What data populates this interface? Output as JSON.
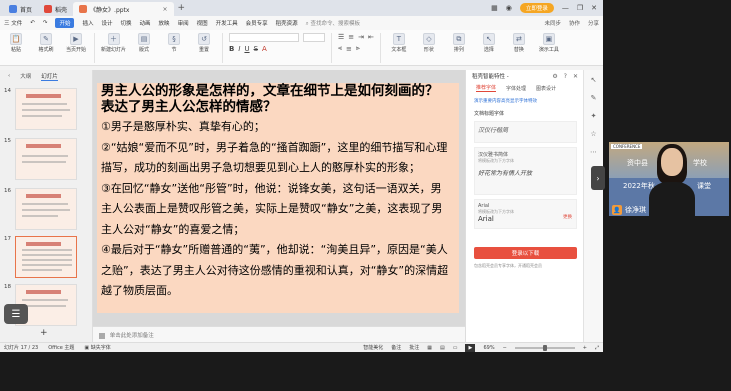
{
  "tabs": [
    {
      "label": "首页",
      "color": "#4a7fe0"
    },
    {
      "label": "稻壳",
      "color": "#e0483a"
    },
    {
      "label": "《静女》.pptx",
      "color": "#e8744a"
    }
  ],
  "window_right": {
    "login_label": "立即登录"
  },
  "menu": {
    "file": "三 文件",
    "start": "开始",
    "items": [
      "插入",
      "设计",
      "切换",
      "动画",
      "放映",
      "审阅",
      "视图",
      "开发工具",
      "会员专享",
      "稻壳资源"
    ],
    "search_placeholder": "查找命令、搜索模板",
    "right": [
      "未同步",
      "协作",
      "分享"
    ]
  },
  "ribbon": {
    "paste": "粘贴",
    "format_painter": "格式刷",
    "current_page_start": "当页开始",
    "new_slide": "新建幻灯片",
    "layout": "版式",
    "section": "节",
    "reset": "重置",
    "textbox": "文本框",
    "shape": "形状",
    "arrange": "排列",
    "select": "选择",
    "replace": "替换",
    "animation": "演示工具"
  },
  "left_pane": {
    "tab_outline": "大纲",
    "tab_slides": "幻灯片",
    "slides": [
      {
        "num": "14"
      },
      {
        "num": "15"
      },
      {
        "num": "16"
      },
      {
        "num": "17"
      },
      {
        "num": "18"
      }
    ]
  },
  "slide": {
    "title": "男主人公的形象是怎样的，文章在细节上是如何刻画的？表达了男主人公怎样的情感？",
    "lines": [
      "①男子是憨厚朴实、真挚有心的；",
      "②“姑娘“爱而不见”时，男子着急的“搔首踟蹰”，这里的细节描写和心理描写，成功的刻画出男子急切想要见到心上人的憨厚朴实的形象；",
      "③在回忆“静女”送他“彤管”时，他说：说锋女美，这句话一语双关，男主人公表面上是赞叹彤管之美，实际上是赞叹“静女”之美，这表现了男主人公对“静女”的喜爱之情；",
      "④最后对于“静女”所赠普通的“荑”，他却说：“洵美且异”，原因是“美人之贻”，表达了男主人公对待这份感情的重视和认真，对“静女”的深情超越了物质层面。"
    ]
  },
  "notes": "单击此处添加备注",
  "right_pane": {
    "title": "稻壳智能特性 -",
    "tabs": [
      "推荐字体",
      "字体处理",
      "图表设计"
    ],
    "link": "演示重要内容高亮显示字体特效",
    "head": "文档标题字体",
    "font1_sample": "汉仪行楷简",
    "font2_name": "汉仪雅书简体",
    "font2_sub": "将模板改为下方字体",
    "font2_sample": "好花常为有情人开放",
    "font3_name": "Arial",
    "font3_sub": "将模板改为下方字体",
    "font3_sample": "Arial",
    "font3_tag": "更换",
    "download": "登录以下载",
    "note": "包含稻壳会员专享字体，开通稻壳会员"
  },
  "statusbar": {
    "page": "幻灯片 17 / 23",
    "theme": "Office 主题",
    "missing_font": "缺失字体",
    "smart_beautify": "智能美化",
    "notes": "备注",
    "comment": "批注",
    "zoom": "69%"
  },
  "cam": {
    "tag": "CONFERENCE",
    "line1": "资中县",
    "line1b": "学校",
    "line2": "2022年秋",
    "line2b": "课堂",
    "name": "徐净琪"
  }
}
